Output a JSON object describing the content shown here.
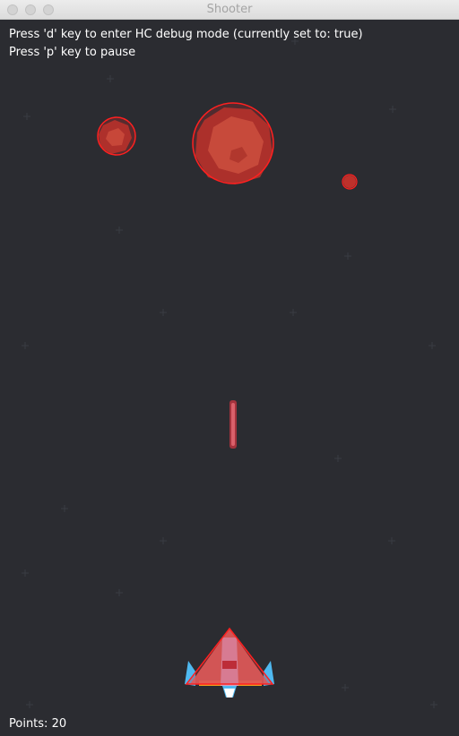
{
  "window": {
    "title": "Shooter"
  },
  "hud": {
    "debug_hint": "Press 'd' key to enter HC debug mode (currently set to: true)",
    "pause_hint": "Press 'p' key to pause",
    "points_label": "Points: 20"
  },
  "colors": {
    "background": "#2b2c31",
    "asteroid": "#c0392b",
    "hitbox": "#ff2a2a",
    "laser": "#c2404a",
    "ship_body": "#e07070",
    "ship_accent": "#4fb9f0"
  },
  "icons": {
    "ship": "player-spaceship-icon",
    "asteroid": "asteroid-icon",
    "laser": "laser-bolt-icon",
    "star": "star-sparkle-icon"
  }
}
